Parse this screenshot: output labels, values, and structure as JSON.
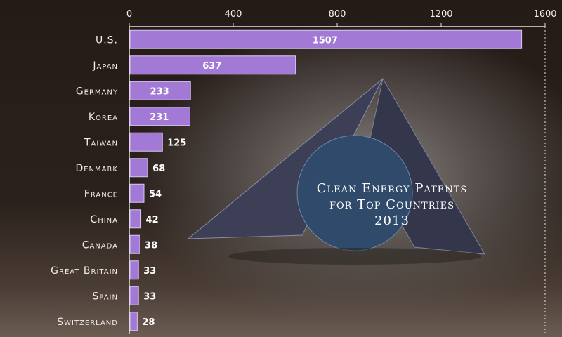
{
  "chart_data": {
    "type": "bar",
    "orientation": "horizontal",
    "title_lines": [
      "Clean Energy Patents",
      "for Top Countries",
      "2013"
    ],
    "categories": [
      "U.S.",
      "Japan",
      "Germany",
      "Korea",
      "Taiwan",
      "Denmark",
      "France",
      "China",
      "Canada",
      "Great Britain",
      "Spain",
      "Switzerland"
    ],
    "values": [
      1507,
      637,
      233,
      231,
      125,
      68,
      54,
      42,
      38,
      33,
      33,
      28
    ],
    "x_ticks": [
      0,
      400,
      800,
      1200,
      1600
    ],
    "xlim": [
      0,
      1600
    ],
    "axis_position": "top",
    "grid": false,
    "bar_color": "#a27ad6"
  }
}
